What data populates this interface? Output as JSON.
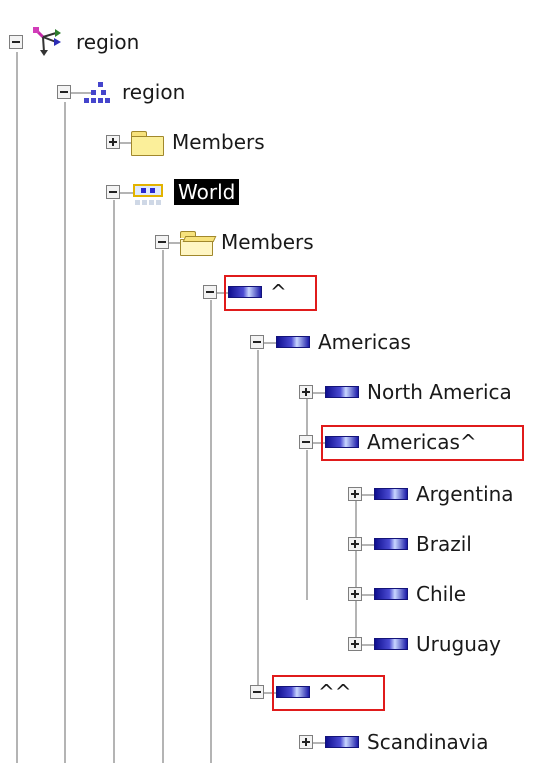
{
  "tree": {
    "dimension": {
      "label": "region",
      "icon": "dimension-icon",
      "expanded": true
    },
    "hierarchy": {
      "label": "region",
      "icon": "hierarchy-icon",
      "expanded": true
    },
    "hierarchy_members": {
      "label": "Members",
      "icon": "folder-closed-icon",
      "expanded": false
    },
    "level_world": {
      "label": "World",
      "icon": "level-icon",
      "expanded": true,
      "selected": true
    },
    "world_members": {
      "label": "Members",
      "icon": "folder-open-icon",
      "expanded": true
    },
    "root_member": {
      "label": "^",
      "icon": "member-icon",
      "expanded": true,
      "highlighted": true
    },
    "americas": {
      "label": "Americas",
      "icon": "member-icon",
      "expanded": true
    },
    "north_america": {
      "label": "North America",
      "icon": "member-icon",
      "expanded": false
    },
    "americas_caret": {
      "label": "Americas^",
      "icon": "member-icon",
      "expanded": true,
      "highlighted": true
    },
    "argentina": {
      "label": "Argentina",
      "icon": "member-icon",
      "expanded": false
    },
    "brazil": {
      "label": "Brazil",
      "icon": "member-icon",
      "expanded": false
    },
    "chile": {
      "label": "Chile",
      "icon": "member-icon",
      "expanded": false
    },
    "uruguay": {
      "label": "Uruguay",
      "icon": "member-icon",
      "expanded": false
    },
    "double_caret": {
      "label": "^^",
      "icon": "member-icon",
      "expanded": true,
      "highlighted": true
    },
    "scandinavia": {
      "label": "Scandinavia",
      "icon": "member-icon",
      "expanded": false
    }
  },
  "colors": {
    "highlight_border": "#e01b1b",
    "selection_background": "#000000",
    "selection_text": "#ffffff",
    "tree_line": "#b4b4b4"
  }
}
